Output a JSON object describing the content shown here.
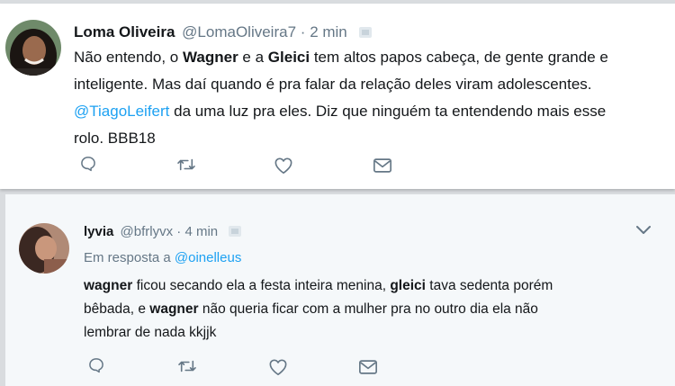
{
  "tweet1": {
    "author_name": "Loma Oliveira",
    "handle": "@LomaOliveira7",
    "separator": "·",
    "time": "2 min",
    "lines": [
      [
        {
          "t": "Não entendo, o ",
          "b": false
        },
        {
          "t": "Wagner",
          "b": true
        },
        {
          "t": " e a ",
          "b": false
        },
        {
          "t": "Gleici",
          "b": true
        },
        {
          "t": " tem altos papos cabeça, de gente grande e",
          "b": false
        }
      ],
      [
        {
          "t": "inteligente. Mas daí quando é pra falar da relação deles viram adolescentes.",
          "b": false
        }
      ],
      [
        {
          "t": "@TiagoLeifert",
          "link": true
        },
        {
          "t": " da uma luz pra eles. Diz que ninguém ta entendendo mais esse",
          "b": false
        }
      ],
      [
        {
          "t": "rolo. BBB18",
          "b": false
        }
      ]
    ],
    "actions": [
      "reply-icon",
      "retweet-icon",
      "like-icon",
      "message-icon"
    ]
  },
  "tweet2": {
    "author_name": "lyvia",
    "handle": "@bfrlyvx",
    "separator": "·",
    "time": "4 min",
    "reply_prefix": "Em resposta a ",
    "reply_to": "@oinelleus",
    "lines": [
      [
        {
          "t": "wagner",
          "b": true
        },
        {
          "t": " ficou secando ela a festa inteira menina, ",
          "b": false
        },
        {
          "t": "gleici",
          "b": true
        },
        {
          "t": " tava sedenta porém",
          "b": false
        }
      ],
      [
        {
          "t": "bêbada, e ",
          "b": false
        },
        {
          "t": "wagner",
          "b": true
        },
        {
          "t": " não queria ficar com a mulher pra no outro dia ela não",
          "b": false
        }
      ],
      [
        {
          "t": "lembrar de nada kkjjk",
          "b": false
        }
      ]
    ],
    "actions": [
      "reply-icon",
      "retweet-icon",
      "like-icon",
      "message-icon"
    ],
    "menu_icon": "chevron-down-icon"
  },
  "colors": {
    "link": "#1da1f2",
    "muted": "#657786",
    "text": "#14171a",
    "icon": "#657786"
  }
}
